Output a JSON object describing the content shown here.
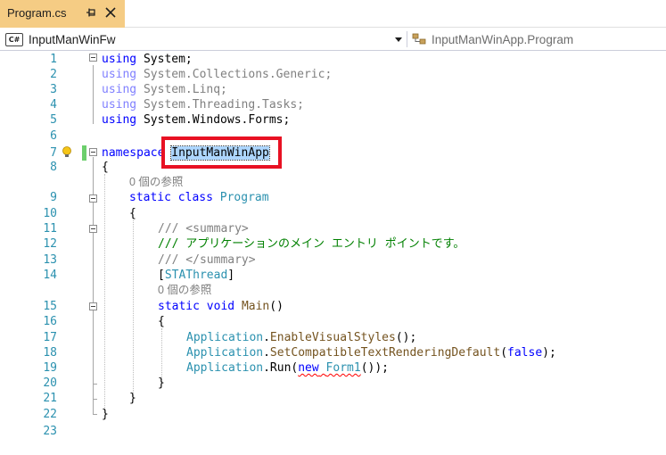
{
  "tab": {
    "title": "Program.cs"
  },
  "navbar": {
    "project_icon_label": "C#",
    "project": "InputManWinFw",
    "scope": "InputManWinApp.Program"
  },
  "code": {
    "line_numbers": [
      "1",
      "2",
      "3",
      "4",
      "5",
      "6",
      "7",
      "8",
      "9",
      "10",
      "11",
      "12",
      "13",
      "14",
      "15",
      "16",
      "17",
      "18",
      "19",
      "20",
      "21",
      "22",
      "23"
    ],
    "using_kw": "using",
    "ns1": "System;",
    "ns2": "System.Collections.Generic;",
    "ns3": "System.Linq;",
    "ns4": "System.Threading.Tasks;",
    "ns5": "System.Windows.Forms;",
    "namespace_kw": "namespace",
    "namespace_name": "InputManWinApp",
    "open_brace": "{",
    "close_brace": "}",
    "refs_label": "0 個の参照",
    "static_kw": "static",
    "class_kw": "class",
    "class_name": "Program",
    "doc_summary_open": "/// <summary>",
    "doc_comment": "/// アプリケーションのメイン エントリ ポイントです。",
    "doc_summary_close": "/// </summary>",
    "attr_open": "[",
    "attr_name": "STAThread",
    "attr_close": "]",
    "void_kw": "void",
    "method_name": "Main",
    "method_parens": "()",
    "app": "Application",
    "dot": ".",
    "call1": "EnableVisualStyles",
    "call1_args": "();",
    "call2": "SetCompatibleTextRenderingDefault",
    "call2_open": "(",
    "false_kw": "false",
    "call2_close": ");",
    "call3": "Run",
    "new_kw": "new",
    "form_type": "Form1",
    "call3_tail": "());"
  },
  "colors": {
    "tab_active": "#f5cc84",
    "keyword": "#0000ff",
    "type": "#2b91af",
    "comment": "#008000",
    "highlight_box": "#e81123"
  }
}
